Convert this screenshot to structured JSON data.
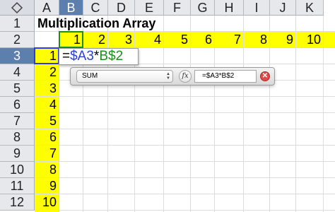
{
  "columns": [
    "A",
    "B",
    "C",
    "D",
    "E",
    "F",
    "G",
    "H",
    "I",
    "J",
    "K"
  ],
  "rows": [
    "1",
    "2",
    "3",
    "4",
    "5",
    "6",
    "7",
    "8",
    "9",
    "10",
    "11",
    "12"
  ],
  "selected_column": "B",
  "selected_row": "3",
  "corner_icon": "select-all-icon",
  "title": "Multiplication Array",
  "header_row_values": [
    "1",
    "2",
    "3",
    "4",
    "5",
    "6",
    "7",
    "8",
    "9",
    "10"
  ],
  "header_col_values": [
    "1",
    "2",
    "3",
    "4",
    "5",
    "6",
    "7",
    "8",
    "9",
    "10"
  ],
  "colors": {
    "highlight": "#ffff00",
    "selected_header": "#5c7fae",
    "ref_a": "#2a3fd6",
    "ref_b": "#1a8f1a"
  },
  "active_cell_formula": {
    "eq": "=",
    "ref_a": "$A3",
    "op": "*",
    "ref_b": "B$2"
  },
  "formula_bar": {
    "function_name": "SUM",
    "fx_label": "fx",
    "formula": "=$A3*B$2",
    "cancel_icon": "cancel-icon"
  }
}
